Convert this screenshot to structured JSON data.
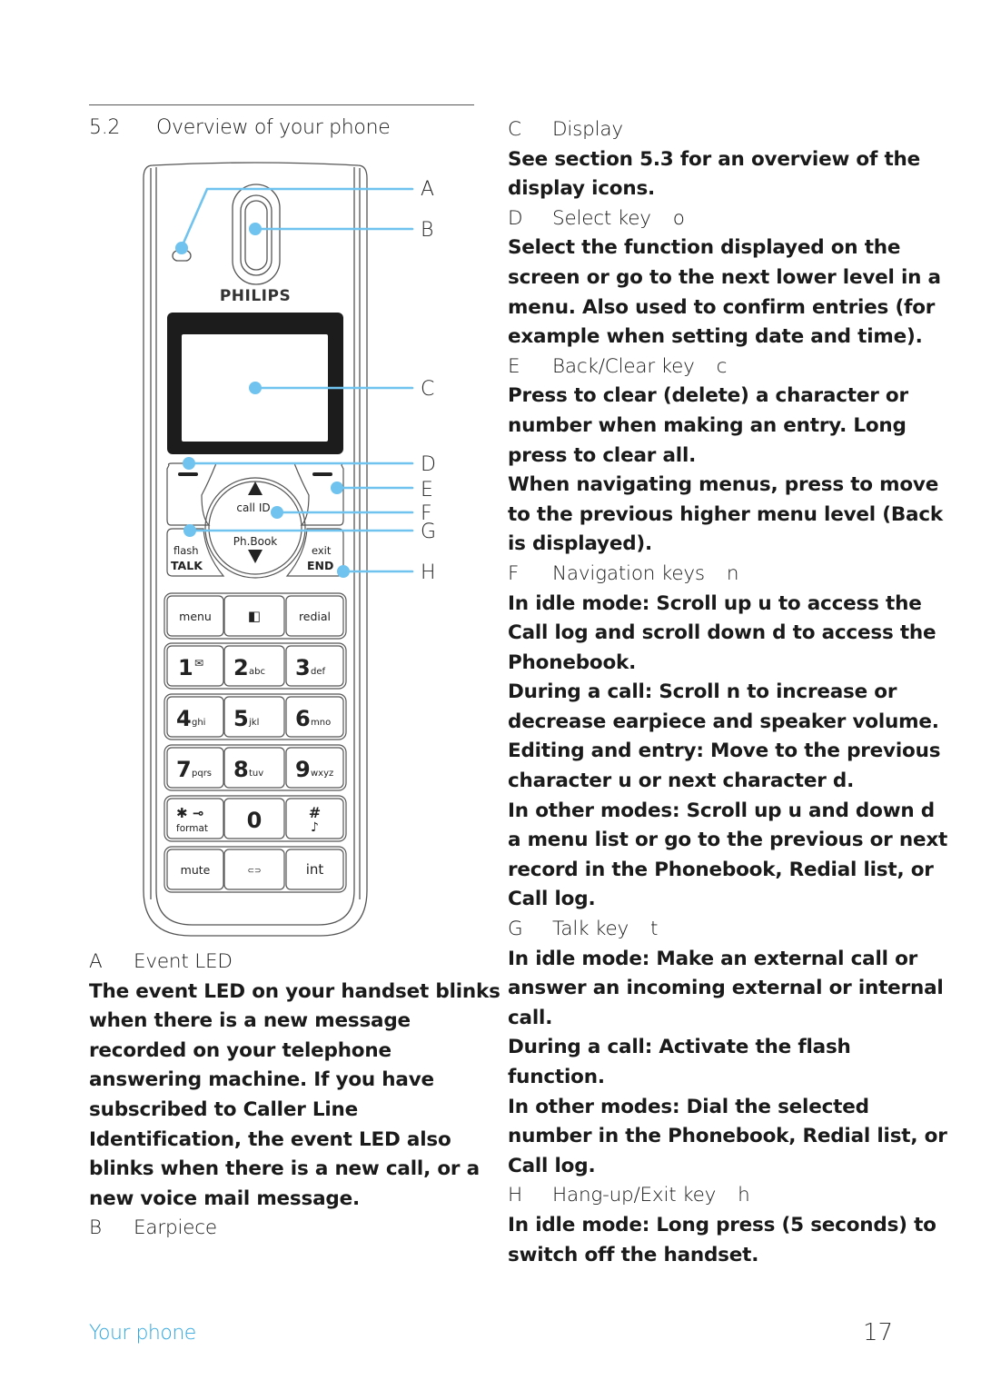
{
  "section": {
    "number": "5.2",
    "title": "Overview of your phone"
  },
  "phone": {
    "brand": "PHILIPS",
    "callouts": [
      "A",
      "B",
      "C",
      "D",
      "E",
      "F",
      "G",
      "H"
    ],
    "accent_color": "#6fc3ee",
    "nav": {
      "up_label": "call ID",
      "down_label": "Ph.Book"
    },
    "talk": {
      "top": "flash",
      "bottom": "TALK"
    },
    "end": {
      "top": "exit",
      "bottom": "END"
    },
    "keys": [
      {
        "main": "menu",
        "sub": ""
      },
      {
        "main": "",
        "sub": "",
        "icon": "speaker-icon"
      },
      {
        "main": "redial",
        "sub": ""
      },
      {
        "main": "1",
        "sub": "",
        "icon": "voicemail-icon"
      },
      {
        "main": "2",
        "sub": "abc"
      },
      {
        "main": "3",
        "sub": "def"
      },
      {
        "main": "4",
        "sub": "ghi"
      },
      {
        "main": "5",
        "sub": "jkl"
      },
      {
        "main": "6",
        "sub": "mno"
      },
      {
        "main": "7",
        "sub": "pqrs"
      },
      {
        "main": "8",
        "sub": "tuv"
      },
      {
        "main": "9",
        "sub": "wxyz"
      },
      {
        "main": "✱ ⊸",
        "sub": "format"
      },
      {
        "main": "0",
        "sub": ""
      },
      {
        "main": "#",
        "sub": "♪"
      },
      {
        "main": "mute",
        "sub": ""
      },
      {
        "main": "",
        "sub": "",
        "icon": "conference-icon"
      },
      {
        "main": "int",
        "sub": ""
      }
    ]
  },
  "items": [
    {
      "letter": "A",
      "title": "Event LED",
      "symbol": "",
      "body": [
        "The event LED on your handset blinks when there is a new message recorded on your telephone answering machine. If you have subscribed to Caller Line Identification, the event LED also blinks when there is a new call, or a new voice mail message."
      ]
    },
    {
      "letter": "B",
      "title": "Earpiece",
      "symbol": "",
      "body": []
    },
    {
      "letter": "C",
      "title": "Display",
      "symbol": "",
      "body": [
        "See section 5.3 for an overview of the display icons."
      ]
    },
    {
      "letter": "D",
      "title": "Select key",
      "symbol": "o",
      "body": [
        "Select the function displayed on the screen or go to the next lower level in a menu. Also used to confirm entries (for example when setting date and time)."
      ]
    },
    {
      "letter": "E",
      "title": "Back/Clear key",
      "symbol": "c",
      "body": [
        "Press to clear (delete) a character or number when making an entry. Long press to clear all.",
        "When navigating menus, press to move to the previous higher menu level (Back is displayed)."
      ]
    },
    {
      "letter": "F",
      "title": "Navigation keys",
      "symbol": "n",
      "body": [
        "In idle mode: Scroll up u to access the Call log and scroll down d to access the Phonebook.",
        "During a call: Scroll n to increase or decrease earpiece and speaker volume.",
        "Editing and entry: Move to the previous character u or next character d.",
        "In other modes: Scroll up u and down d a menu list or go to the previous or next record in the Phonebook, Redial list, or Call log."
      ]
    },
    {
      "letter": "G",
      "title": "Talk key",
      "symbol": "t",
      "body": [
        "In idle mode: Make an external call or answer an incoming external or internal call.",
        "During a call: Activate the flash function.",
        "In other modes: Dial the selected number in the Phonebook, Redial list, or Call log."
      ]
    },
    {
      "letter": "H",
      "title": "Hang-up/Exit key",
      "symbol": "h",
      "body": [
        "In idle mode: Long press (5 seconds) to switch off the handset."
      ]
    }
  ],
  "footer": {
    "section_name": "Your phone",
    "page_number": "17",
    "accent_color": "#2fa6df"
  }
}
